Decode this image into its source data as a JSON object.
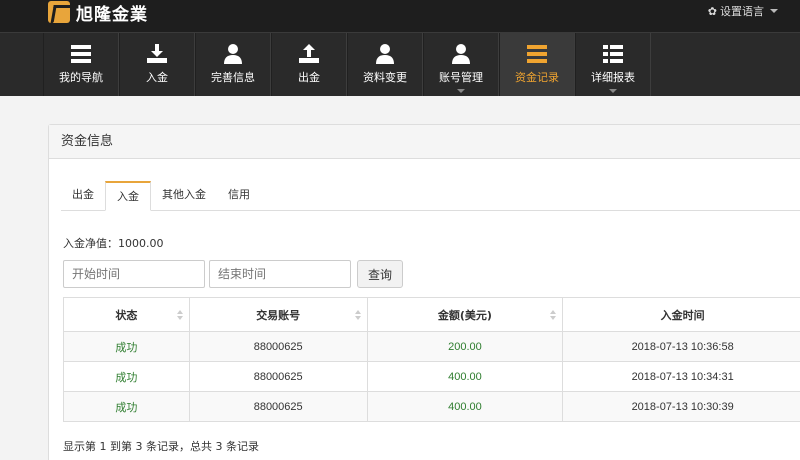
{
  "brand": {
    "name": "旭隆金業"
  },
  "lang": {
    "label": "设置语言"
  },
  "nav": [
    {
      "label": "我的导航",
      "icon": "menu-icon",
      "active": false,
      "has_caret": false
    },
    {
      "label": "入金",
      "icon": "download-icon",
      "active": false,
      "has_caret": false
    },
    {
      "label": "完善信息",
      "icon": "user-icon",
      "active": false,
      "has_caret": false
    },
    {
      "label": "出金",
      "icon": "upload-icon",
      "active": false,
      "has_caret": false
    },
    {
      "label": "资料变更",
      "icon": "user-icon",
      "active": false,
      "has_caret": false
    },
    {
      "label": "账号管理",
      "icon": "user-icon",
      "active": false,
      "has_caret": true
    },
    {
      "label": "资金记录",
      "icon": "menu-icon",
      "active": true,
      "has_caret": false
    },
    {
      "label": "详细报表",
      "icon": "list-icon",
      "active": false,
      "has_caret": true
    }
  ],
  "panel": {
    "title": "资金信息"
  },
  "tabs": [
    "出金",
    "入金",
    "其他入金",
    "信用"
  ],
  "active_tab": 1,
  "net_deposit": "入金净值：1000.00",
  "search": {
    "start_placeholder": "开始时间",
    "end_placeholder": "结束时间",
    "button": "查询"
  },
  "table": {
    "headers": [
      "状态",
      "交易账号",
      "金额(美元)",
      "入金时间"
    ],
    "rows": [
      {
        "status": "成功",
        "account": "88000625",
        "amount": "200.00",
        "time": "2018-07-13 10:36:58"
      },
      {
        "status": "成功",
        "account": "88000625",
        "amount": "400.00",
        "time": "2018-07-13 10:34:31"
      },
      {
        "status": "成功",
        "account": "88000625",
        "amount": "400.00",
        "time": "2018-07-13 10:30:39"
      }
    ]
  },
  "pagination_info": "显示第 1 到第 3 条记录，总共 3 条记录",
  "colors": {
    "accent": "#e8a53b",
    "success": "#2e7d2e",
    "nav_bg": "#2a2a2a"
  }
}
